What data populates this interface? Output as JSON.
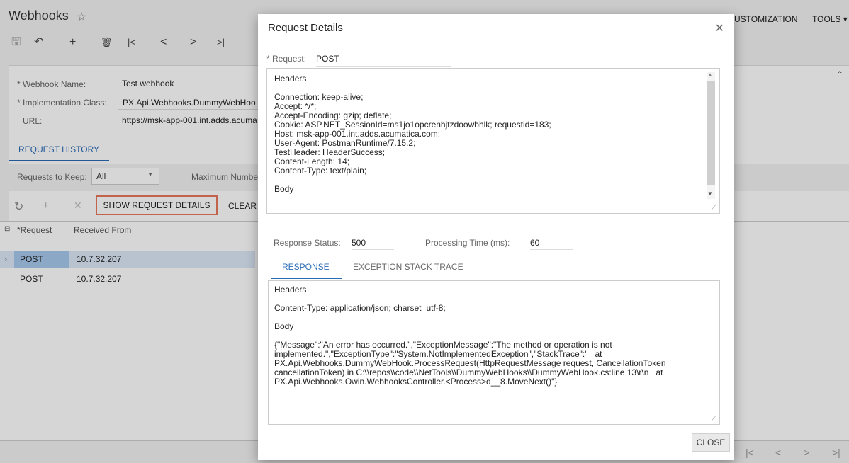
{
  "page": {
    "title": "Webhooks",
    "star": "☆",
    "customization": "USTOMIZATION",
    "tools": "TOOLS ▾",
    "toolbar": {
      "save": "🖫",
      "undo": "↶",
      "add": "+",
      "delete": "🗑",
      "first": "|<",
      "prev": "<",
      "next": ">",
      "last": ">|"
    },
    "form": {
      "webhook_name_label": "* Webhook Name:",
      "webhook_name_value": "Test webhook",
      "impl_class_label": "* Implementation Class:",
      "impl_class_value": "PX.Api.Webhooks.DummyWebHoo",
      "url_label": "URL:",
      "url_value": "https://msk-app-001.int.adds.acuma"
    },
    "history_tab": "REQUEST HISTORY",
    "requests_to_keep_label": "Requests to Keep:",
    "requests_to_keep_value": "All",
    "max_number_label": "Maximum Numbe",
    "grid_toolbar": {
      "refresh": "↻",
      "add": "+",
      "delete": "✕",
      "show_details": "SHOW REQUEST DETAILS",
      "clear": "CLEAR"
    },
    "grid": {
      "columns": [
        "*Request",
        "Received From"
      ],
      "rows": [
        {
          "request": "POST",
          "received_from": "10.7.32.207"
        },
        {
          "request": "POST",
          "received_from": "10.7.32.207"
        }
      ]
    },
    "pager": {
      "first": "|<",
      "prev": "<",
      "next": ">",
      "last": ">|"
    }
  },
  "dialog": {
    "title": "Request Details",
    "close_x": "✕",
    "request_label": "* Request:",
    "request_value": "POST",
    "request_box": "Headers\n\nConnection: keep-alive;\nAccept: */*;\nAccept-Encoding: gzip; deflate;\nCookie: ASP.NET_SessionId=ms1jo1opcrenhjtzdoowbhlk; requestid=183;\nHost: msk-app-001.int.adds.acumatica.com;\nUser-Agent: PostmanRuntime/7.15.2;\nTestHeader: HeaderSuccess;\nContent-Length: 14;\nContent-Type: text/plain;\n\nBody",
    "response_status_label": "Response Status:",
    "response_status_value": "500",
    "processing_time_label": "Processing Time (ms):",
    "processing_time_value": "60",
    "tabs": [
      "RESPONSE",
      "EXCEPTION STACK TRACE"
    ],
    "response_box": "Headers\n\nContent-Type: application/json; charset=utf-8;\n\nBody\n\n{\"Message\":\"An error has occurred.\",\"ExceptionMessage\":\"The method or operation is not\nimplemented.\",\"ExceptionType\":\"System.NotImplementedException\",\"StackTrace\":\"   at\nPX.Api.Webhooks.DummyWebHook.ProcessRequest(HttpRequestMessage request, CancellationToken\ncancellationToken) in C:\\\\repos\\\\code\\\\NetTools\\\\DummyWebHooks\\\\DummyWebHook.cs:line 13\\r\\n   at\nPX.Api.Webhooks.Owin.WebhooksController.<Process>d__8.MoveNext()\"}",
    "close_button": "CLOSE"
  }
}
